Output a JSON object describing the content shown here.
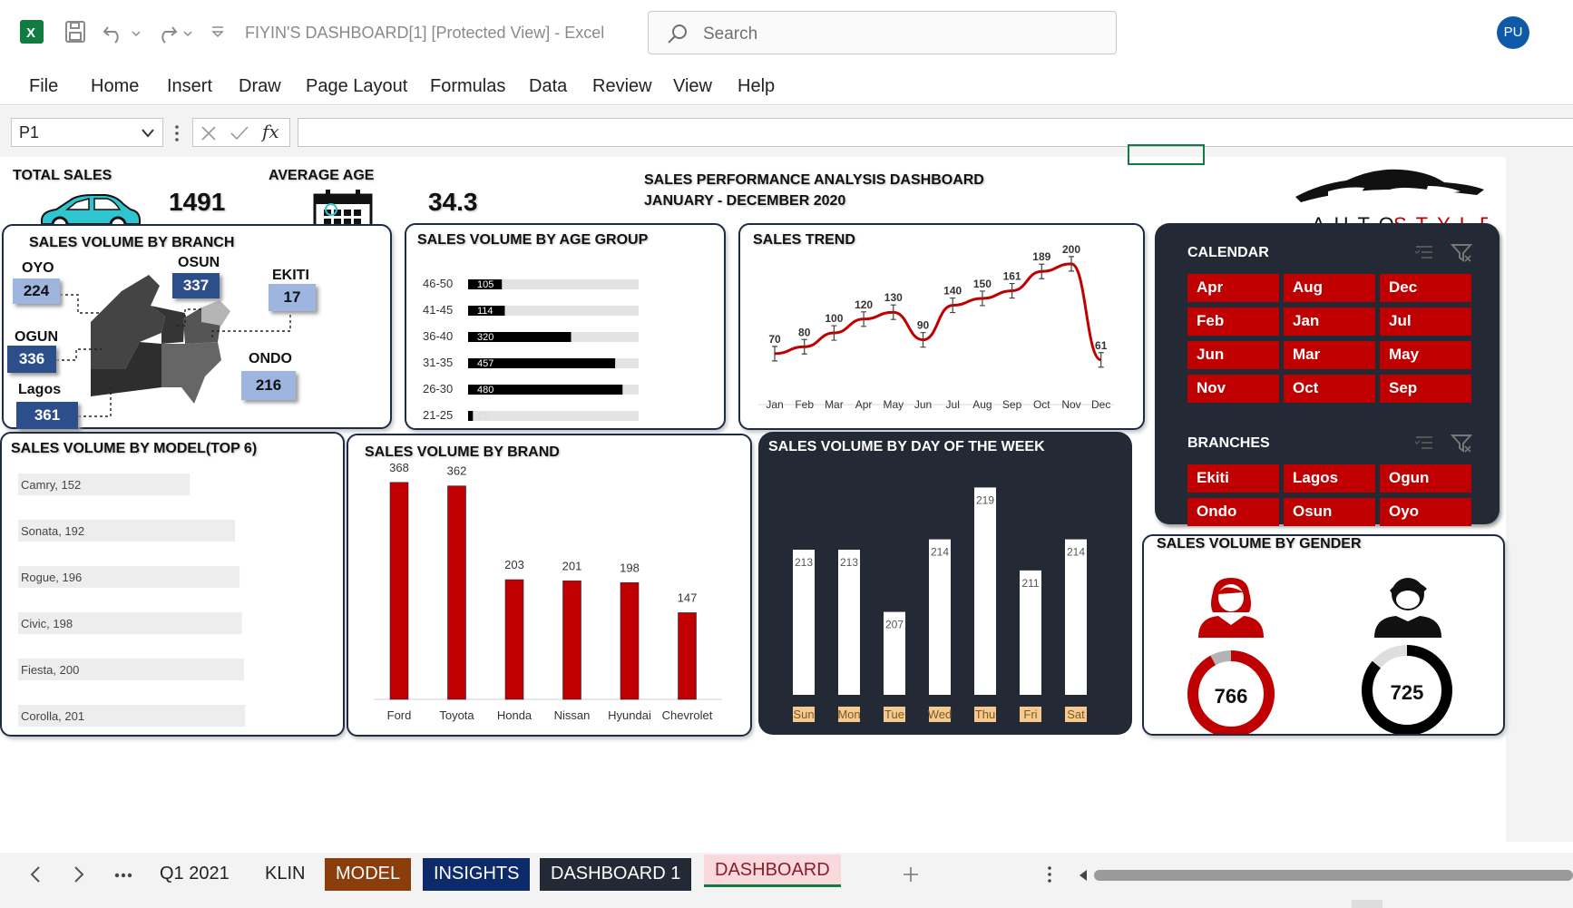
{
  "window": {
    "title": "FIYIN'S DASHBOARD[1]  [Protected View]  -  Excel",
    "search_placeholder": "Search",
    "user_initials": "PU"
  },
  "menu": [
    "File",
    "Home",
    "Insert",
    "Draw",
    "Page Layout",
    "Formulas",
    "Data",
    "Review",
    "View",
    "Help"
  ],
  "formula_bar": {
    "name_box": "P1",
    "fx_label": "fx",
    "formula": ""
  },
  "kpis": {
    "total_sales_label": "TOTAL SALES",
    "total_sales_value": "1491",
    "average_age_label": "AVERAGE AGE",
    "average_age_value": "34.3"
  },
  "dashboard_title": {
    "line1": "SALES PERFORMANCE ANALYSIS DASHBOARD",
    "line2": "JANUARY - DECEMBER 2020"
  },
  "logo_text": "AUTOSTYLE",
  "branch_panel": {
    "title": "SALES VOLUME BY BRANCH",
    "branches": [
      {
        "name": "OYO",
        "value": "224",
        "style": "light"
      },
      {
        "name": "OSUN",
        "value": "337",
        "style": "dark"
      },
      {
        "name": "EKITI",
        "value": "17",
        "style": "light"
      },
      {
        "name": "OGUN",
        "value": "336",
        "style": "dark"
      },
      {
        "name": "ONDO",
        "value": "216",
        "style": "light"
      },
      {
        "name": "Lagos",
        "value": "361",
        "style": "dark"
      }
    ]
  },
  "age_panel": {
    "title": "SALES VOLUME BY AGE GROUP",
    "chart_data": {
      "type": "bar",
      "orientation": "horizontal",
      "categories": [
        "46-50",
        "41-45",
        "36-40",
        "31-35",
        "26-30",
        "21-25"
      ],
      "values": [
        105,
        114,
        320,
        457,
        480,
        15
      ],
      "xlim": [
        0,
        530
      ]
    }
  },
  "trend_panel": {
    "title": "SALES TREND",
    "chart_data": {
      "type": "line",
      "categories": [
        "Jan",
        "Feb",
        "Mar",
        "Apr",
        "May",
        "Jun",
        "Jul",
        "Aug",
        "Sep",
        "Oct",
        "Nov",
        "Dec"
      ],
      "values": [
        70,
        80,
        100,
        120,
        130,
        90,
        140,
        150,
        161,
        189,
        200,
        61
      ],
      "ylim": [
        20,
        230
      ],
      "error_bars": true
    }
  },
  "calendar_slicer": {
    "title": "CALENDAR",
    "items": [
      "Apr",
      "Aug",
      "Dec",
      "Feb",
      "Jan",
      "Jul",
      "Jun",
      "Mar",
      "May",
      "Nov",
      "Oct",
      "Sep"
    ]
  },
  "branch_slicer": {
    "title": "BRANCHES",
    "items": [
      "Ekiti",
      "Lagos",
      "Ogun",
      "Ondo",
      "Osun",
      "Oyo"
    ]
  },
  "model_panel": {
    "title": "SALES VOLUME BY MODEL(TOP 6)",
    "chart_data": {
      "type": "bar",
      "orientation": "horizontal",
      "categories": [
        "Camry",
        "Sonata",
        "Rogue",
        "Civic",
        "Fiesta",
        "Corolla"
      ],
      "values": [
        152,
        192,
        196,
        198,
        200,
        201
      ],
      "data_labels": [
        "Camry, 152",
        "Sonata, 192",
        "Rogue, 196",
        "Civic, 198",
        "Fiesta, 200",
        "Corolla, 201"
      ],
      "xlim": [
        0,
        220
      ]
    }
  },
  "brand_panel": {
    "title": "SALES VOLUME BY BRAND",
    "chart_data": {
      "type": "bar",
      "categories": [
        "Ford",
        "Toyota",
        "Honda",
        "Nissan",
        "Hyundai",
        "Chevrolet"
      ],
      "values": [
        368,
        362,
        203,
        201,
        198,
        147
      ],
      "ylim": [
        0,
        400
      ],
      "color": "#c00000"
    }
  },
  "day_panel": {
    "title": "SALES VOLUME BY DAY OF THE WEEK",
    "chart_data": {
      "type": "bar",
      "categories": [
        "Sun",
        "Mon",
        "Tue",
        "Wed",
        "Thu",
        "Fri",
        "Sat"
      ],
      "values": [
        213,
        213,
        207,
        214,
        219,
        211,
        214
      ],
      "ylim": [
        199,
        220
      ],
      "color": "#ffffff"
    }
  },
  "gender_panel": {
    "title": "SALES VOLUME BY GENDER",
    "female_value": "766",
    "male_value": "725",
    "female_share": 0.92,
    "male_share": 0.86
  },
  "sheet_tabs": [
    {
      "label": "Q1 2021",
      "bg": "",
      "fg": "#222222"
    },
    {
      "label": "KLIN",
      "bg": "",
      "fg": "#222222"
    },
    {
      "label": "MODEL",
      "bg": "#8b3d0c",
      "fg": "#ffffff"
    },
    {
      "label": "INSIGHTS",
      "bg": "#0d2a6b",
      "fg": "#ffffff"
    },
    {
      "label": "DASHBOARD 1",
      "bg": "#232a36",
      "fg": "#ffffff"
    },
    {
      "label": "DASHBOARD",
      "bg": "#f9d9dc",
      "fg": "#8b1c2a"
    }
  ],
  "colors": {
    "accent_red": "#c00000",
    "dark_panel": "#232a36",
    "navy_border": "#1f2a44",
    "excel_green": "#107c41"
  }
}
